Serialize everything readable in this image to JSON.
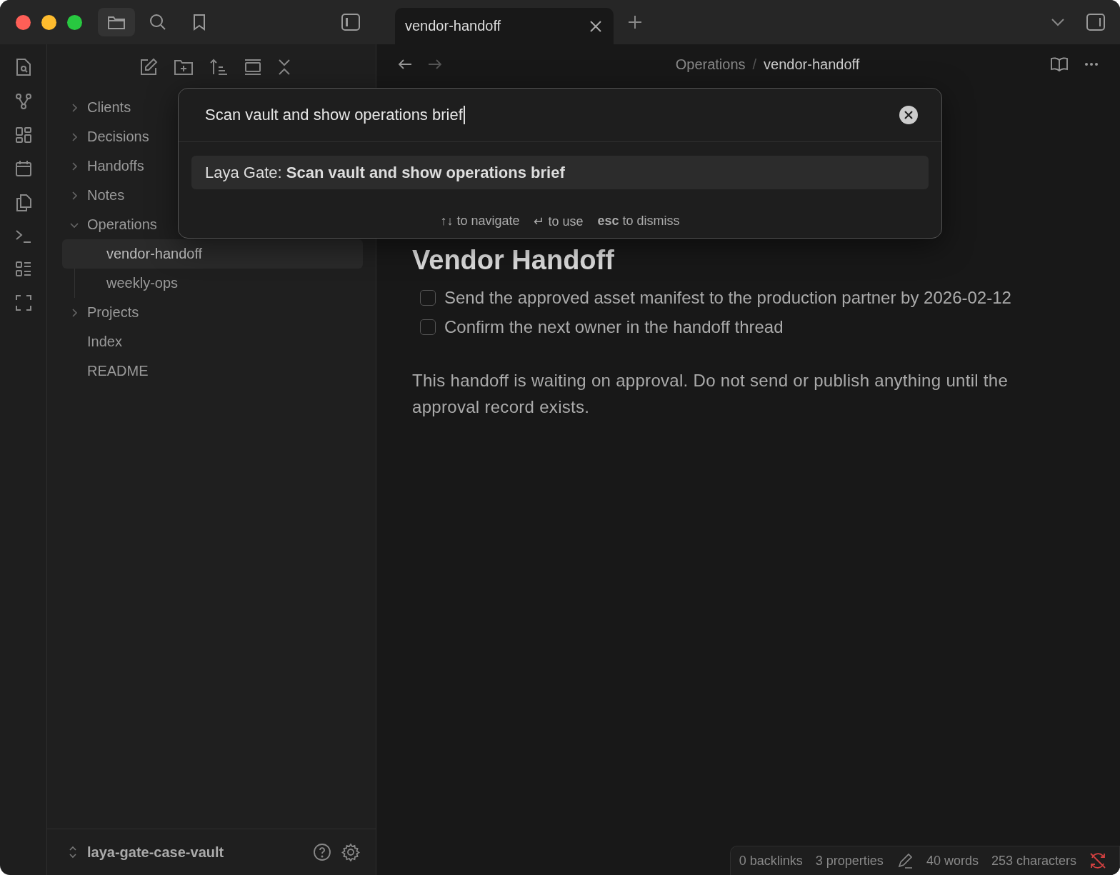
{
  "tabs": [
    {
      "label": "vendor-handoff",
      "selected": true
    }
  ],
  "file_tree": [
    {
      "label": "Clients",
      "kind": "folder",
      "expanded": false,
      "selected": false
    },
    {
      "label": "Decisions",
      "kind": "folder",
      "expanded": false,
      "selected": false
    },
    {
      "label": "Handoffs",
      "kind": "folder",
      "expanded": false,
      "selected": false
    },
    {
      "label": "Notes",
      "kind": "folder",
      "expanded": false,
      "selected": false
    },
    {
      "label": "Operations",
      "kind": "folder",
      "expanded": true,
      "selected": false,
      "children": [
        {
          "label": "vendor-handoff",
          "selected": true
        },
        {
          "label": "weekly-ops",
          "selected": false
        }
      ]
    },
    {
      "label": "Projects",
      "kind": "folder",
      "expanded": false,
      "selected": false
    },
    {
      "label": "Index",
      "kind": "file",
      "selected": false
    },
    {
      "label": "README",
      "kind": "file",
      "selected": false
    }
  ],
  "vault": {
    "name": "laya-gate-case-vault"
  },
  "breadcrumb": {
    "separator": "/",
    "items": [
      "Operations",
      "vendor-handoff"
    ]
  },
  "note": {
    "title": "Vendor Handoff",
    "tasks": [
      {
        "text": "Send the approved asset manifest to the production partner by 2026-02-12",
        "checked": false
      },
      {
        "text": "Confirm the next owner in the handoff thread",
        "checked": false
      }
    ],
    "paragraph": "This handoff is waiting on approval. Do not send or publish anything until the approval record exists."
  },
  "command_palette": {
    "value": "Scan vault and show operations brief",
    "results": [
      {
        "text": "Laya Gate: **Scan vault and show operations brief**",
        "selected": true
      }
    ],
    "hints": [
      "↑↓ to navigate",
      "↵ to use",
      "**esc** to dismiss"
    ]
  },
  "status_bar": {
    "backlinks": "0 backlinks",
    "properties": "3 properties",
    "words": "40 words",
    "characters": "253 characters"
  }
}
